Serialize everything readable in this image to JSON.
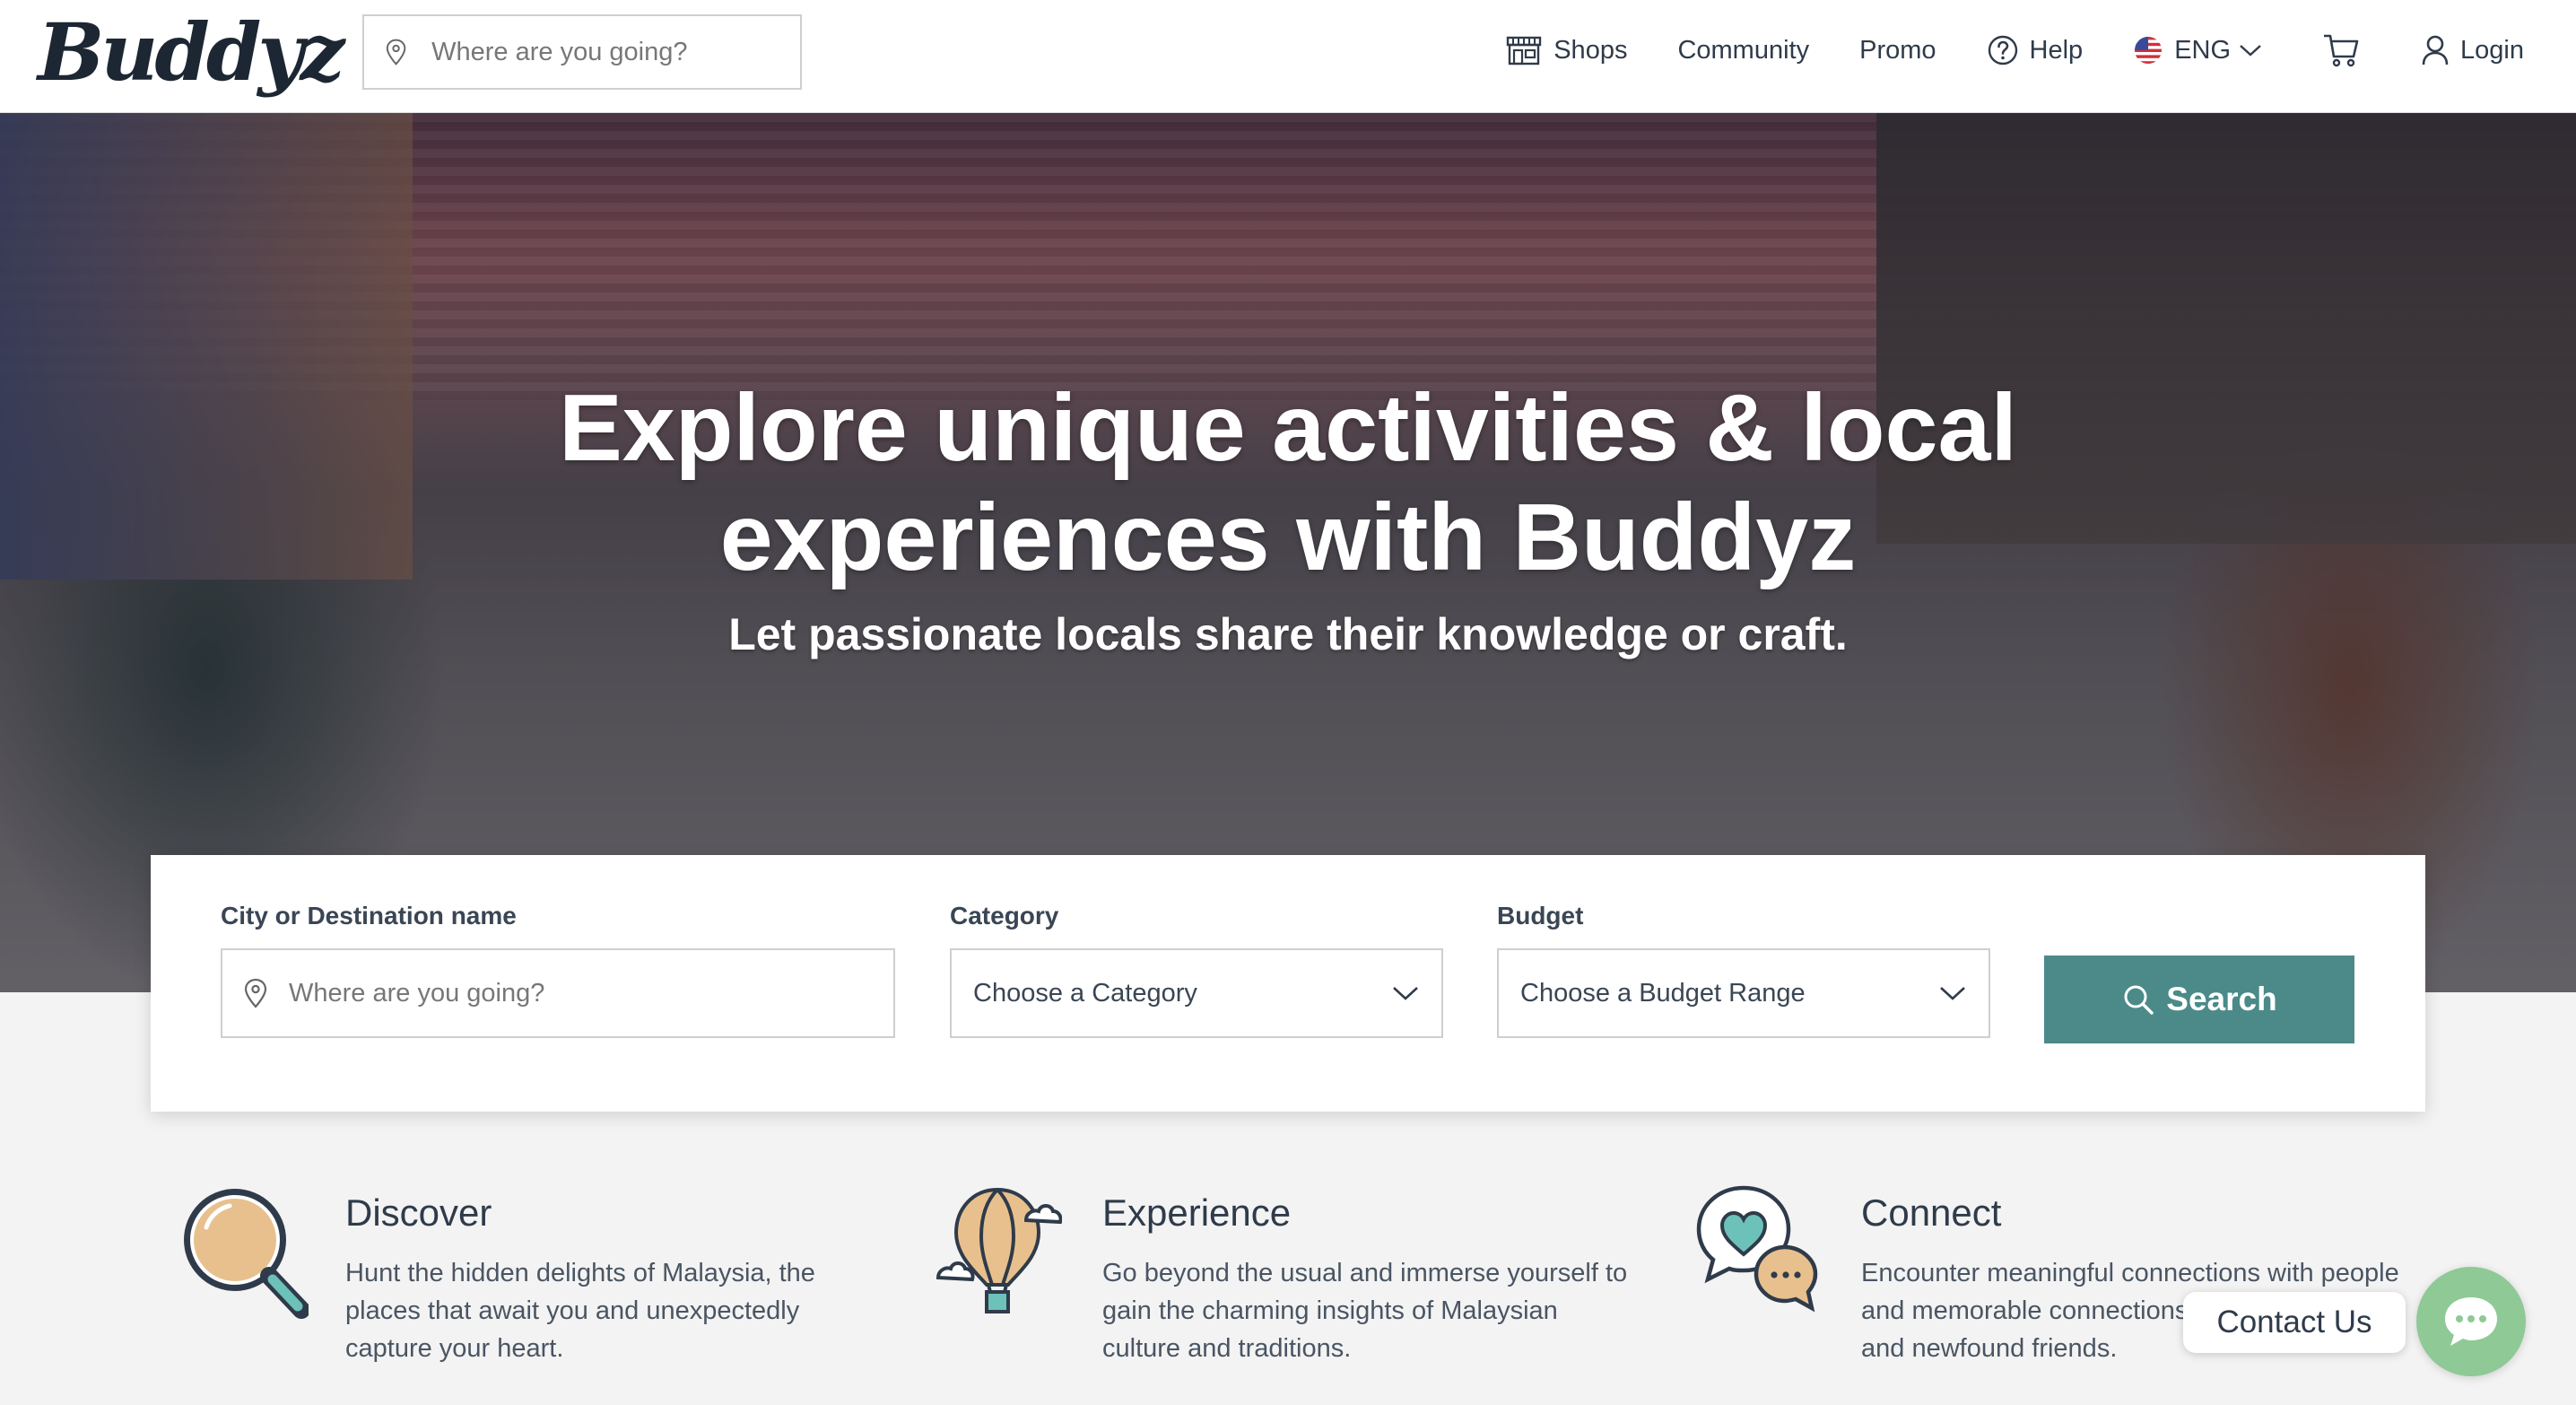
{
  "header": {
    "logo_text": "Buddyz",
    "search_placeholder": "Where are you going?",
    "nav": {
      "shops": "Shops",
      "community": "Community",
      "promo": "Promo",
      "help": "Help",
      "language": "ENG",
      "login": "Login"
    }
  },
  "hero": {
    "title_line1": "Explore unique activities & local",
    "title_line2": "experiences with Buddyz",
    "subtitle": "Let passionate locals share their knowledge or craft."
  },
  "search_form": {
    "city_label": "City or Destination name",
    "city_placeholder": "Where are you going?",
    "category_label": "Category",
    "category_value": "Choose a Category",
    "budget_label": "Budget",
    "budget_value": "Choose a Budget Range",
    "search_button": "Search"
  },
  "features": [
    {
      "title": "Discover",
      "description": "Hunt the hidden delights of Malaysia, the places that await you and unexpectedly capture your heart.",
      "icon": "magnifier-icon"
    },
    {
      "title": "Experience",
      "description": "Go beyond the usual and immerse yourself to gain the charming insights of Malaysian culture and traditions.",
      "icon": "hot-air-balloon-icon"
    },
    {
      "title": "Connect",
      "description": "Encounter meaningful connections with people and memorable connections with strangers and newfound friends.",
      "icon": "chat-heart-icon"
    }
  ],
  "contact": {
    "label": "Contact Us"
  },
  "colors": {
    "accent": "#4b8a89",
    "contact_green": "#8fc996",
    "text_dark": "#2f3b4a",
    "icon_tan": "#e8c08e",
    "icon_teal": "#6cc1b8"
  }
}
